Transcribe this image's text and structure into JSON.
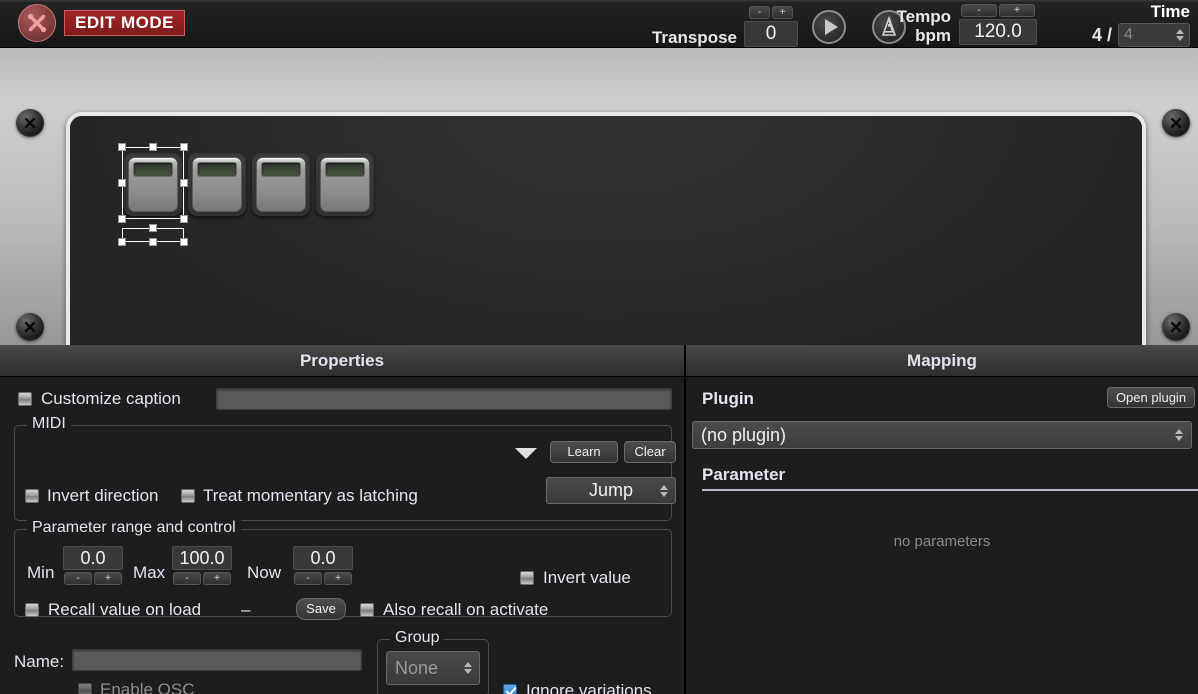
{
  "topbar": {
    "edit_mode_label": "EDIT MODE",
    "wrench_icon": "wrench-cross-icon",
    "transpose_label": "Transpose",
    "transpose_value": "0",
    "minus_label": "-",
    "plus_label": "+",
    "play_icon": "play-icon",
    "metronome_icon": "metronome-icon",
    "tempo_label": "Tempo",
    "tempo_unit_label": "bpm",
    "tempo_value": "120.0",
    "time_title": "Time",
    "time_numerator": "4 /",
    "time_denominator": "4"
  },
  "canvas": {
    "pedals": [
      {
        "name": "pedal-1",
        "selected": true
      },
      {
        "name": "pedal-2",
        "selected": false
      },
      {
        "name": "pedal-3",
        "selected": false
      },
      {
        "name": "pedal-4",
        "selected": false
      }
    ]
  },
  "properties": {
    "title": "Properties",
    "customize_caption_label": "Customize caption",
    "customize_caption_checked": false,
    "caption_value": "",
    "midi": {
      "title": "MIDI",
      "learn_label": "Learn",
      "clear_label": "Clear",
      "dropdown_icon": "caret-down-icon",
      "invert_direction_label": "Invert direction",
      "invert_direction_checked": false,
      "treat_momentary_label": "Treat momentary as latching",
      "treat_momentary_checked": false,
      "mode_value": "Jump"
    },
    "range": {
      "title": "Parameter range and control",
      "min_label": "Min",
      "min_value": "0.0",
      "max_label": "Max",
      "max_value": "100.0",
      "now_label": "Now",
      "now_value": "0.0",
      "minus_label": "-",
      "plus_label": "+",
      "invert_value_label": "Invert value",
      "invert_value_checked": false,
      "recall_on_load_label": "Recall value on load",
      "recall_on_load_checked": false,
      "dash": "–",
      "save_label": "Save",
      "also_recall_label": "Also recall on activate",
      "also_recall_checked": false
    },
    "name_label": "Name:",
    "name_value": "",
    "enable_osc_label": "Enable OSC",
    "enable_osc_checked": false,
    "group": {
      "title": "Group",
      "value": "None"
    },
    "ignore_variations_label": "Ignore variations",
    "ignore_variations_checked": true
  },
  "mapping": {
    "title": "Mapping",
    "plugin_label": "Plugin",
    "open_plugin_label": "Open plugin",
    "plugin_value": "(no plugin)",
    "parameter_label": "Parameter",
    "no_parameters_text": "no parameters"
  },
  "colors": {
    "accent_red": "#a02525",
    "checkbox_blue": "#2f7fd0",
    "panel_bg": "#1d1d1d",
    "metal": "#c4c4c4",
    "lcd_green": "#3c4a38"
  }
}
